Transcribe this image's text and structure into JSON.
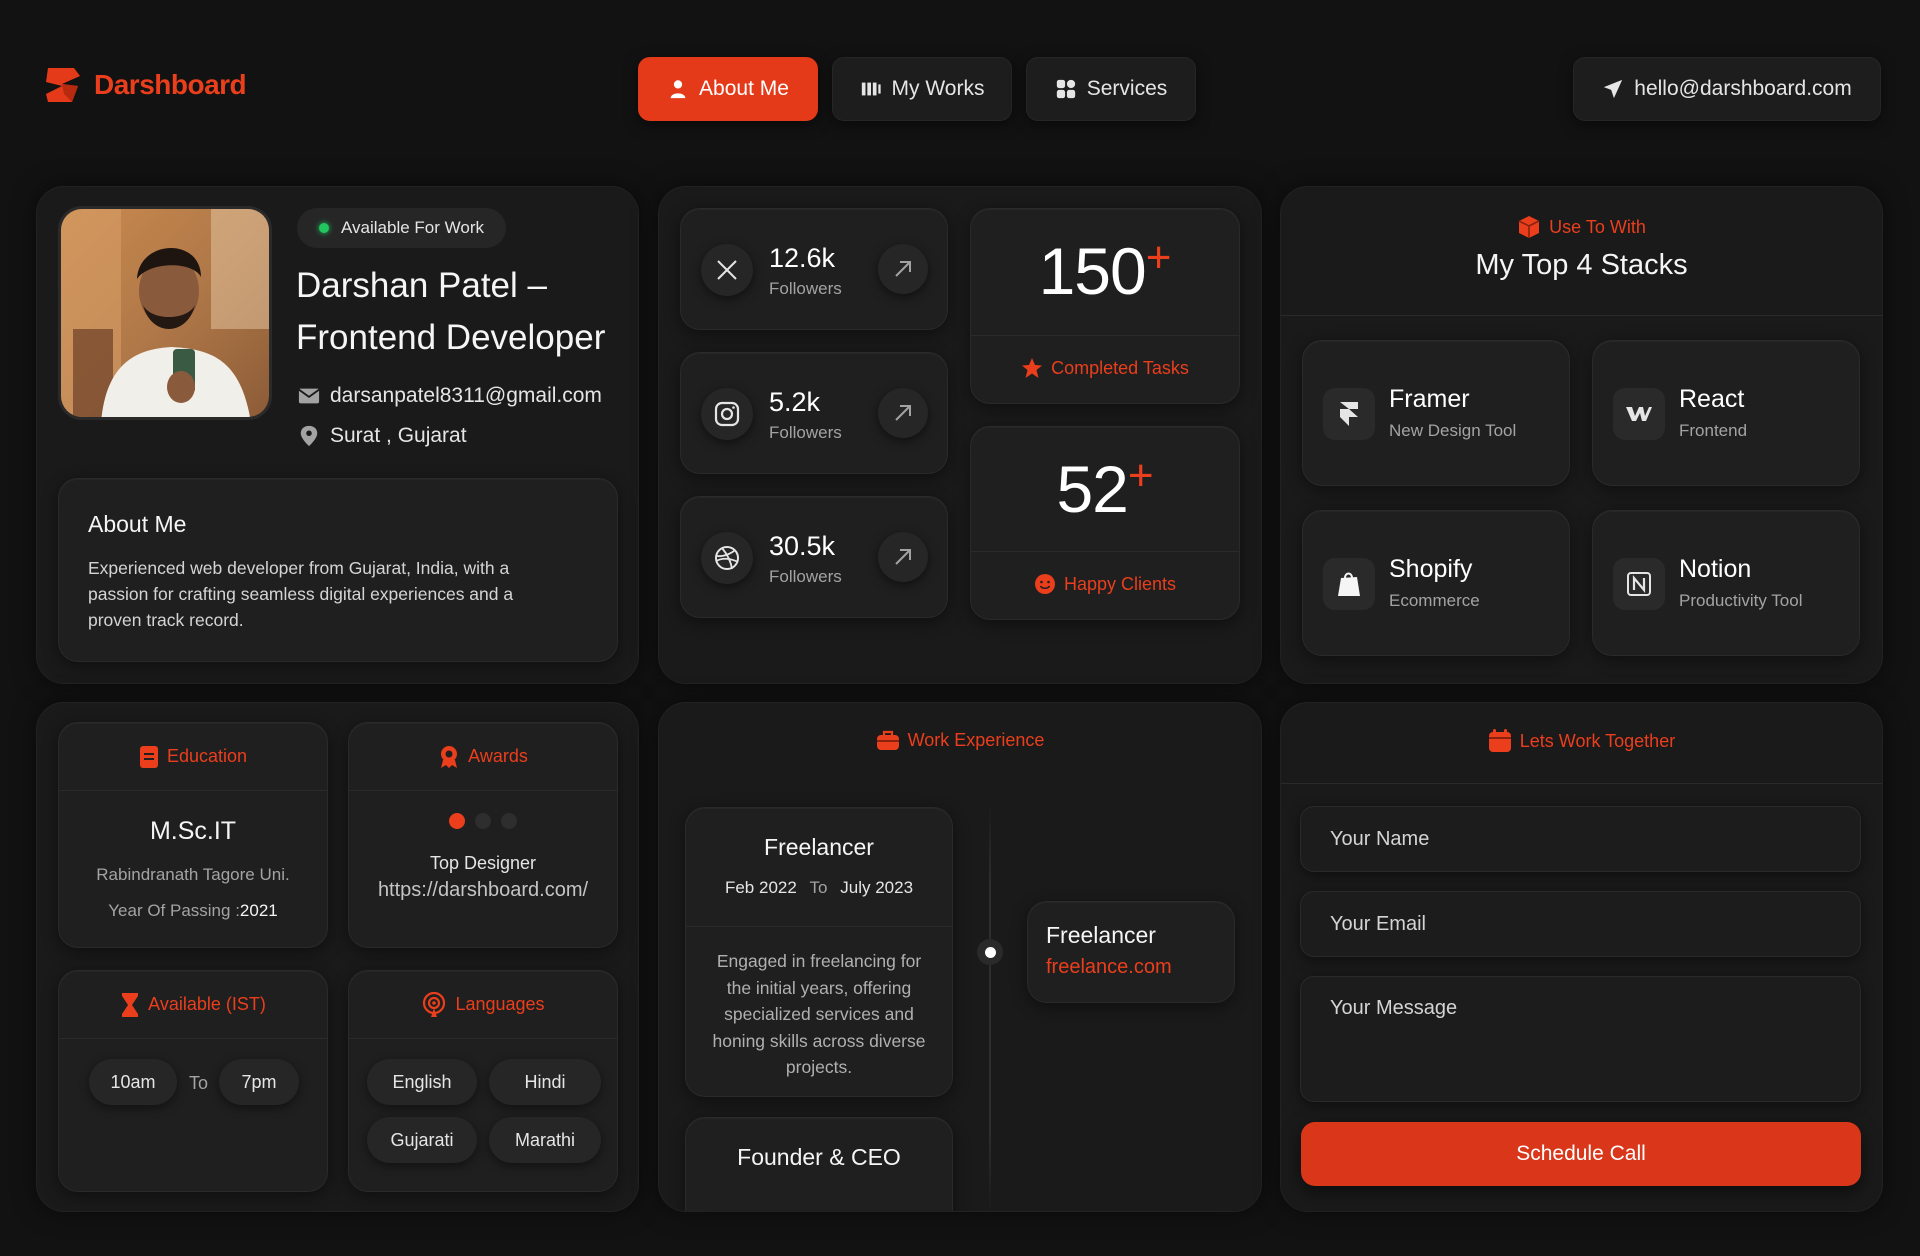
{
  "brand": {
    "name": "Darshboard",
    "accent": "#ea3e1c"
  },
  "nav": {
    "about": "About Me",
    "works": "My Works",
    "services": "Services",
    "email": "hello@darshboard.com"
  },
  "profile": {
    "status": "Available For Work",
    "name_line1": "Darshan Patel –",
    "name_line2": "Frontend Developer",
    "email": "darsanpatel8311@gmail.com",
    "location": "Surat , Gujarat",
    "about_title": "About Me",
    "about_text": "Experienced web developer from Gujarat, India, with a passion for crafting seamless digital experiences and a proven track record."
  },
  "social": [
    {
      "icon": "x-icon",
      "count": "12.6k",
      "label": "Followers"
    },
    {
      "icon": "instagram-icon",
      "count": "5.2k",
      "label": "Followers"
    },
    {
      "icon": "dribbble-icon",
      "count": "30.5k",
      "label": "Followers"
    }
  ],
  "stats": {
    "tasks_number": "150",
    "tasks_plus": "+",
    "tasks_label": "Completed Tasks",
    "clients_number": "52",
    "clients_plus": "+",
    "clients_label": "Happy Clients"
  },
  "stacks": {
    "eyebrow": "Use To With",
    "title": "My Top 4 Stacks",
    "items": [
      {
        "icon": "framer-icon",
        "name": "Framer",
        "sub": "New Design Tool"
      },
      {
        "icon": "webflow-icon",
        "name": "React",
        "sub": "Frontend"
      },
      {
        "icon": "shopify-icon",
        "name": "Shopify",
        "sub": "Ecommerce"
      },
      {
        "icon": "notion-icon",
        "name": "Notion",
        "sub": "Productivity Tool"
      }
    ]
  },
  "education": {
    "title": "Education",
    "degree": "M.Sc.IT",
    "school": "Rabindranath Tagore Uni.",
    "year_label": "Year Of Passing :",
    "year": "2021"
  },
  "awards": {
    "title": "Awards",
    "award": "Top Designer",
    "url": "https://darshboard.com/"
  },
  "availability": {
    "title": "Available (IST)",
    "from": "10am",
    "sep": "To",
    "to": "7pm"
  },
  "languages": {
    "title": "Languages",
    "items": [
      "English",
      "Hindi",
      "Gujarati",
      "Marathi"
    ]
  },
  "experience": {
    "title": "Work Experience",
    "role": "Freelancer",
    "from": "Feb 2022",
    "sep": "To",
    "to": "July 2023",
    "desc": "Engaged in freelancing for the initial years, offering specialized services and honing skills across diverse projects.",
    "company_role": "Freelancer",
    "company": "freelance.com",
    "next_role": "Founder & CEO"
  },
  "contact": {
    "title": "Lets Work Together",
    "name_placeholder": "Your Name",
    "email_placeholder": "Your Email",
    "message_placeholder": "Your Message",
    "submit": "Schedule Call"
  }
}
